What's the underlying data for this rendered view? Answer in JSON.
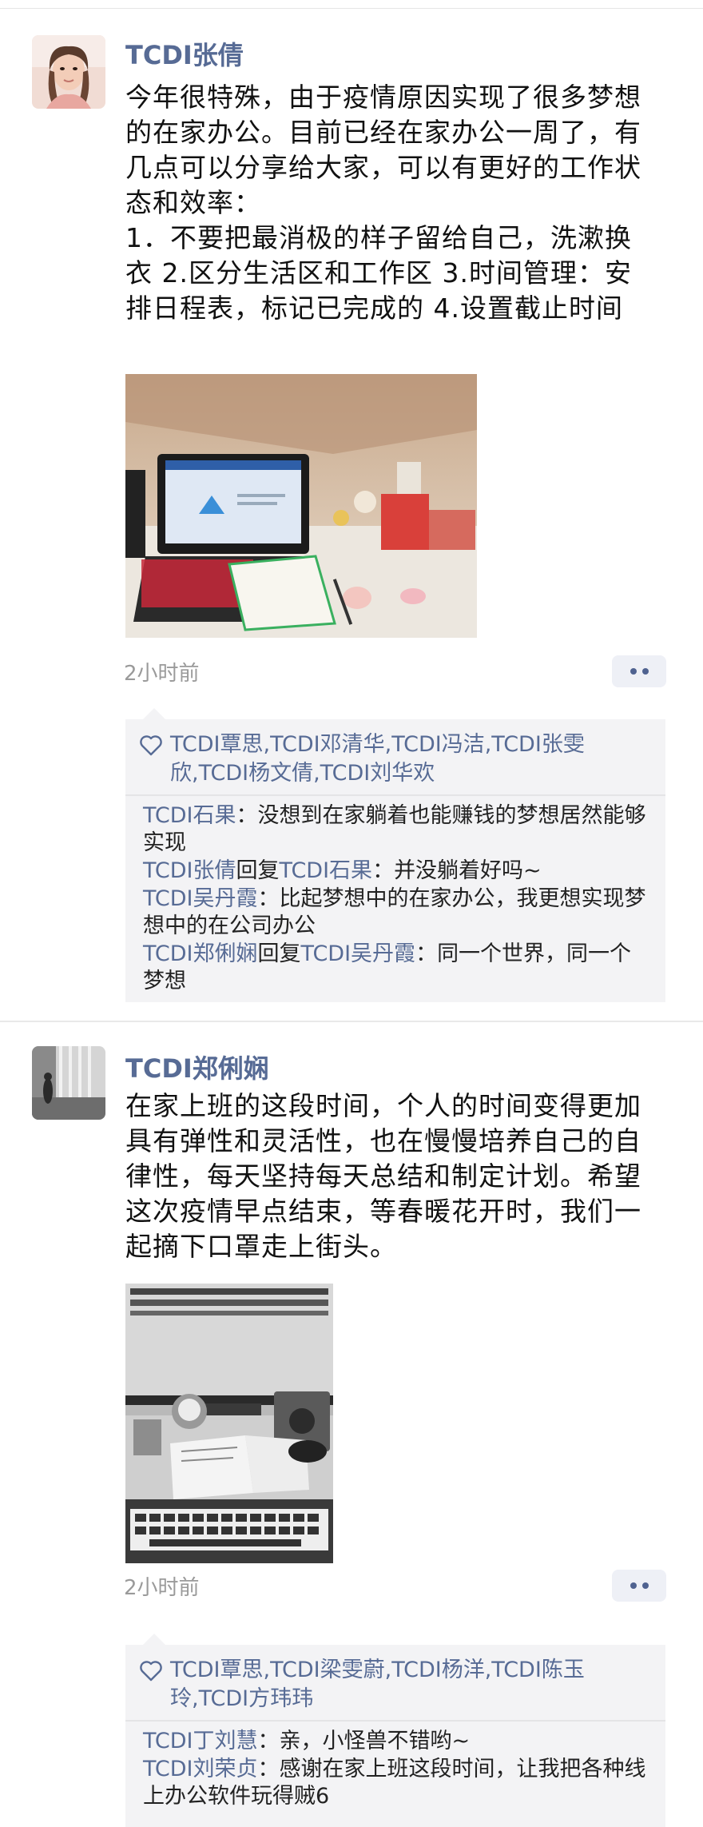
{
  "posts": [
    {
      "author": "TCDI张倩",
      "text": "今年很特殊，由于疫情原因实现了很多梦想的在家办公。目前已经在家办公一周了，有几点可以分享给大家，可以有更好的工作状态和效率：\n1．不要把最消极的样子留给自己，洗漱换衣 2.区分生活区和工作区 3.时间管理：安排日程表，标记已完成的 4.设置截止时间",
      "time": "2小时前",
      "likes": "TCDI覃思,TCDI邓清华,TCDI冯洁,TCDI张雯欣,TCDI杨文倩,TCDI刘华欢",
      "comments": [
        {
          "name": "TCDI石果",
          "reply_word": "",
          "reply_to": "",
          "sep": "：",
          "text": "没想到在家躺着也能赚钱的梦想居然能够实现"
        },
        {
          "name": "TCDI张倩",
          "reply_word": "回复",
          "reply_to": "TCDI石果",
          "sep": "：",
          "text": "并没躺着好吗~"
        },
        {
          "name": "TCDI吴丹霞",
          "reply_word": "",
          "reply_to": "",
          "sep": "：",
          "text": "比起梦想中的在家办公，我更想实现梦想中的在公司办公"
        },
        {
          "name": "TCDI郑俐娴",
          "reply_word": "回复",
          "reply_to": "TCDI吴丹霞",
          "sep": "：",
          "text": "同一个世界，同一个梦想"
        }
      ]
    },
    {
      "author": "TCDI郑俐娴",
      "text": "在家上班的这段时间，个人的时间变得更加具有弹性和灵活性，也在慢慢培养自己的自律性，每天坚持每天总结和制定计划。希望这次疫情早点结束，等春暖花开时，我们一起摘下口罩走上街头。",
      "time": "2小时前",
      "likes": "TCDI覃思,TCDI梁雯蔚,TCDI杨洋,TCDI陈玉玲,TCDI方玮玮",
      "comments": [
        {
          "name": "TCDI丁刘慧",
          "reply_word": "",
          "reply_to": "",
          "sep": "：",
          "text": "亲，小怪兽不错哟~"
        },
        {
          "name": "TCDI刘荣贞",
          "reply_word": "",
          "reply_to": "",
          "sep": "：",
          "text": "感谢在家上班这段时间，让我把各种线上办公软件玩得贼6"
        }
      ]
    }
  ],
  "icons": {
    "like": "heart-icon",
    "more": "more-dots-icon"
  },
  "colors": {
    "name_link": "#576b95",
    "time": "#9a9a9a",
    "comment_bg": "#f3f3f5"
  }
}
